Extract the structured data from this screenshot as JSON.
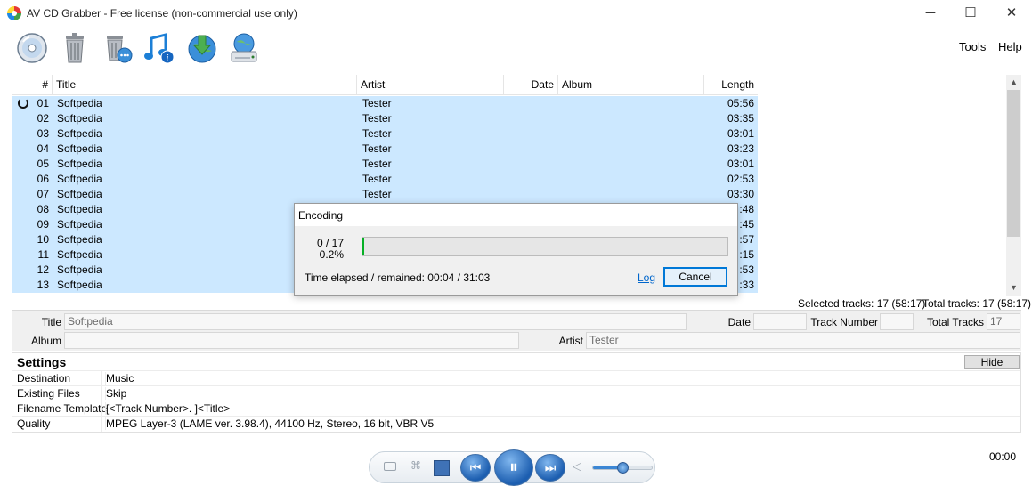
{
  "window": {
    "title": "AV CD Grabber - Free license (non-commercial use only)",
    "minimize": "─",
    "maximize": "☐",
    "close": "✕"
  },
  "toolbar": {
    "buttons": [
      "cd-icon",
      "trash-icon",
      "trash-options-icon",
      "music-info-icon",
      "download-globe-icon",
      "network-drive-icon"
    ],
    "menu_tools": "Tools",
    "menu_help": "Help"
  },
  "tracklist": {
    "columns": {
      "num": "#",
      "title": "Title",
      "artist": "Artist",
      "date": "Date",
      "album": "Album",
      "length": "Length"
    },
    "rows": [
      {
        "num": "01",
        "title": "Softpedia",
        "artist": "Tester",
        "length": "05:56"
      },
      {
        "num": "02",
        "title": "Softpedia",
        "artist": "Tester",
        "length": "03:35"
      },
      {
        "num": "03",
        "title": "Softpedia",
        "artist": "Tester",
        "length": "03:01"
      },
      {
        "num": "04",
        "title": "Softpedia",
        "artist": "Tester",
        "length": "03:23"
      },
      {
        "num": "05",
        "title": "Softpedia",
        "artist": "Tester",
        "length": "03:01"
      },
      {
        "num": "06",
        "title": "Softpedia",
        "artist": "Tester",
        "length": "02:53"
      },
      {
        "num": "07",
        "title": "Softpedia",
        "artist": "Tester",
        "length": "03:30"
      },
      {
        "num": "08",
        "title": "Softpedia",
        "artist": "",
        "length": ":48"
      },
      {
        "num": "09",
        "title": "Softpedia",
        "artist": "",
        "length": ":45"
      },
      {
        "num": "10",
        "title": "Softpedia",
        "artist": "",
        "length": ":57"
      },
      {
        "num": "11",
        "title": "Softpedia",
        "artist": "",
        "length": ":15"
      },
      {
        "num": "12",
        "title": "Softpedia",
        "artist": "",
        "length": ":53"
      },
      {
        "num": "13",
        "title": "Softpedia",
        "artist": "",
        "length": ":33"
      }
    ],
    "selected_tracks": "Selected tracks: 17 (58:17)",
    "total_tracks": "Total tracks: 17 (58:17)"
  },
  "tags": {
    "title_label": "Title",
    "title_value": "Softpedia",
    "date_label": "Date",
    "date_value": "",
    "track_number_label": "Track Number",
    "track_number_value": "",
    "total_tracks_label": "Total Tracks",
    "total_tracks_value": "17",
    "album_label": "Album",
    "album_value": "",
    "artist_label": "Artist",
    "artist_value": "Tester"
  },
  "settings": {
    "heading": "Settings",
    "hide_label": "Hide",
    "rows": [
      {
        "key": "Destination",
        "value": "Music"
      },
      {
        "key": "Existing Files",
        "value": "Skip"
      },
      {
        "key": "Filename Template",
        "value": "[<Track Number>. ]<Title>"
      },
      {
        "key": "Quality",
        "value": "MPEG Layer-3 (LAME ver. 3.98.4), 44100 Hz, Stereo, 16 bit, VBR V5"
      }
    ]
  },
  "player": {
    "time": "00:00",
    "volume": 0.5
  },
  "dialog": {
    "title": "Encoding",
    "count": "0 / 17",
    "percent": "0.2%",
    "progress": 0.002,
    "elapsed": "Time elapsed / remained: 00:04 / 31:03",
    "log_label": "Log",
    "cancel_label": "Cancel"
  },
  "colors": {
    "selection": "#cce8ff",
    "progress": "#06b025",
    "accent": "#0078d7"
  }
}
